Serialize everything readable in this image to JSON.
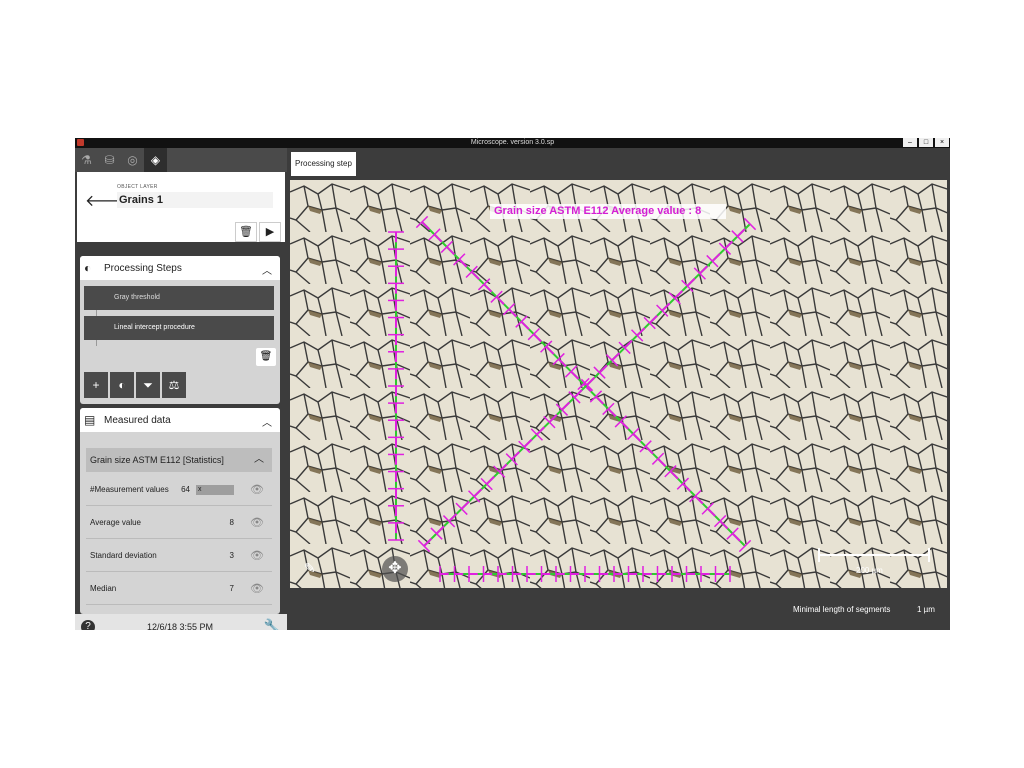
{
  "window": {
    "title": "Microscope. version 3.0.sp",
    "buttons": [
      "–",
      "□",
      "×"
    ]
  },
  "left": {
    "object_layer_label": "OBJECT LAYER",
    "object_name": "Grains 1",
    "processing_steps": {
      "title": "Processing Steps",
      "steps": [
        "Gray threshold",
        "Lineal intercept procedure"
      ]
    },
    "measured": {
      "title": "Measured data",
      "group": "Grain size ASTM E112 [Statistics]",
      "rows": [
        {
          "label": "#Measurement values",
          "value": "64",
          "unit": "x"
        },
        {
          "label": "Average value",
          "value": "8"
        },
        {
          "label": "Standard deviation",
          "value": "3"
        },
        {
          "label": "Median",
          "value": "7"
        }
      ]
    },
    "footer": {
      "datetime": "12/6/18 3:55 PM",
      "help": "?"
    }
  },
  "view": {
    "tab": "Processing step",
    "overlay_label": "Grain size ASTM E112 Average value : 8",
    "scale_bar": "200 µm"
  },
  "status": {
    "min_length_label": "Minimal length of segments",
    "min_length_value": "1 µm"
  },
  "colors": {
    "overlay": "#e020e0",
    "green_line": "#2ecc2e",
    "bg": "#3c3c3c"
  }
}
